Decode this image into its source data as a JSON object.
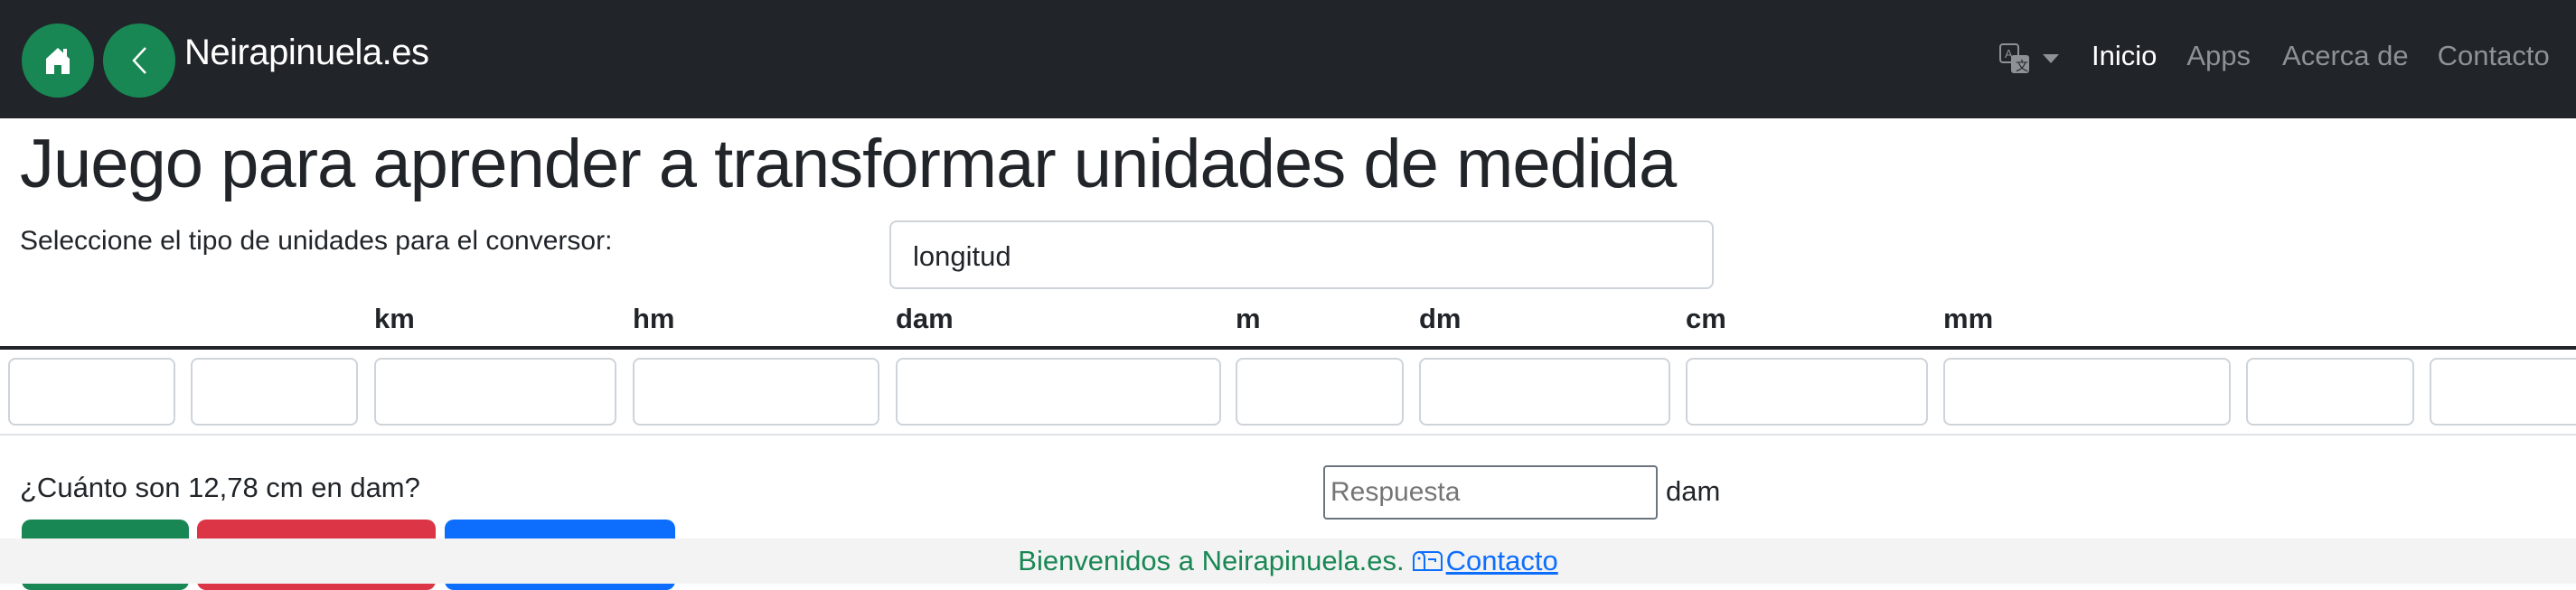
{
  "navbar": {
    "brand": "Neirapinuela.es",
    "home_icon": "house-icon",
    "back_icon": "chevron-left-icon",
    "language_icon": "translate-icon",
    "links": [
      {
        "label": "Inicio",
        "active": true
      },
      {
        "label": "Apps",
        "active": false
      },
      {
        "label": "Acerca de",
        "active": false
      },
      {
        "label": "Contacto",
        "active": false
      }
    ]
  },
  "main": {
    "title": "Juego para aprender a transformar unidades de medida",
    "select_label": "Seleccione el tipo de unidades para el conversor:",
    "select_value": "longitud",
    "units": [
      "km",
      "hm",
      "dam",
      "m",
      "dm",
      "cm",
      "mm"
    ],
    "unit_inputs_count": 11,
    "question": "¿Cuánto son 12,78 cm en dam?",
    "answer_placeholder": "Respuesta",
    "answer_unit": "dam"
  },
  "colors": {
    "success": "#198754",
    "danger": "#dc3545",
    "primary": "#0d6efd",
    "navbar": "#212529"
  },
  "footer": {
    "text": "Bienvenidos a Neirapinuela.es.",
    "link_label": "Contacto",
    "link_icon": "mailbox-icon"
  }
}
